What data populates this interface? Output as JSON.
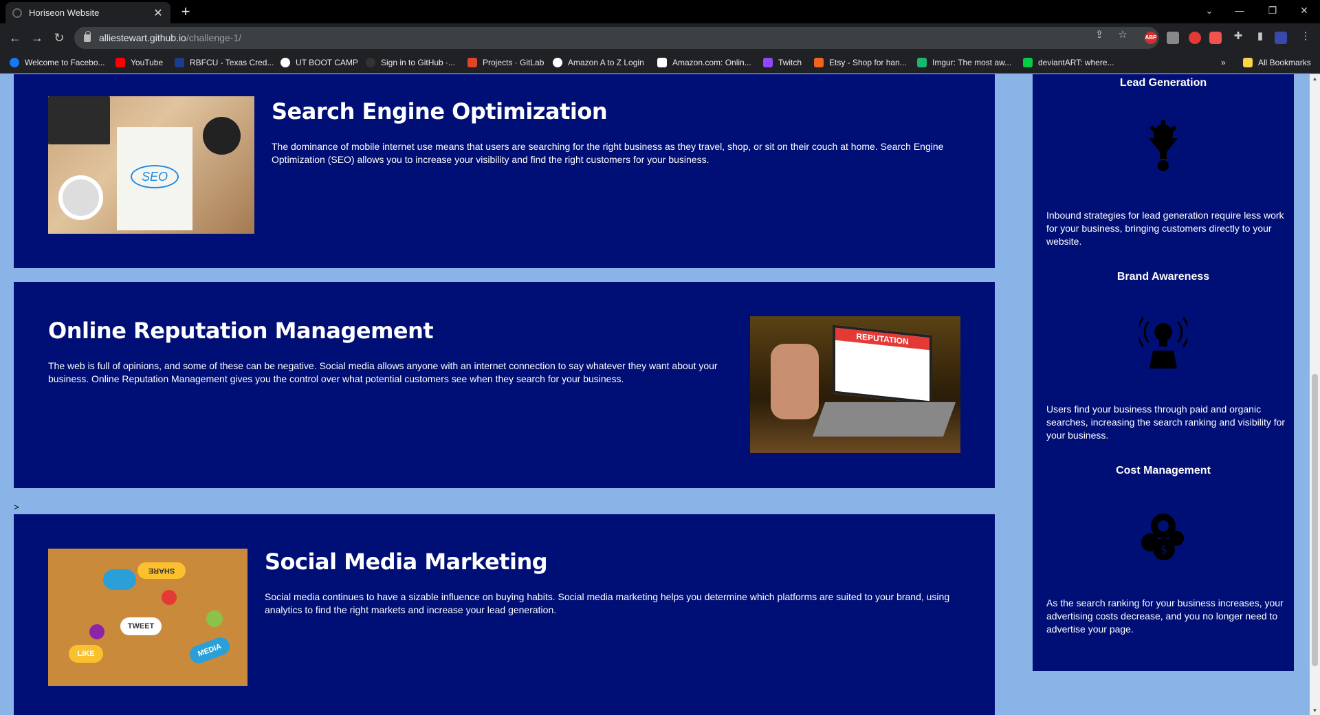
{
  "browser": {
    "tab_title": "Horiseon Website",
    "url_host": "alliestewart.github.io",
    "url_path": "/challenge-1/",
    "bookmarks": [
      "Welcome to Facebo...",
      "YouTube",
      "RBFCU - Texas Cred...",
      "UT BOOT CAMP",
      "Sign in to GitHub ·...",
      "Projects · GitLab",
      "Amazon A to Z Login",
      "Amazon.com: Onlin...",
      "Twitch",
      "Etsy - Shop for han...",
      "Imgur: The most aw...",
      "deviantART: where...",
      "All Bookmarks"
    ],
    "overflow_label": "»",
    "extensions": [
      "ABP"
    ]
  },
  "page": {
    "stray_text": ">",
    "seo": {
      "heading": "Search Engine Optimization",
      "text": "The dominance of mobile internet use means that users are searching for the right business as they travel, shop, or sit on their couch at home. Search Engine Optimization (SEO) allows you to increase your visibility and find the right customers for your business.",
      "image_text": "SEO"
    },
    "orm": {
      "heading": "Online Reputation Management",
      "text": "The web is full of opinions, and some of these can be negative. Social media allows anyone with an internet connection to say whatever they want about your business. Online Reputation Management gives you the control over what potential customers see when they search for your business.",
      "image_text": "REPUTATION"
    },
    "smm": {
      "heading": "Social Media Marketing",
      "text": "Social media continues to have a sizable influence on buying habits. Social media marketing helps you determine which platforms are suited to your brand, using analytics to find the right markets and increase your lead generation.",
      "image_words": [
        "SHARE",
        "TWEET",
        "LIKE",
        "MEDIA"
      ]
    },
    "benefits": [
      {
        "title": "Lead Generation",
        "text": "Inbound strategies for lead generation require less work for your business, bringing customers directly to your website."
      },
      {
        "title": "Brand Awareness",
        "text": "Users find your business through paid and organic searches, increasing the search ranking and visibility for your business."
      },
      {
        "title": "Cost Management",
        "text": "As the search ranking for your business increases, your advertising costs decrease, and you no longer need to advertise your page."
      }
    ]
  },
  "colors": {
    "page_bg": "#8ab4e8",
    "card_bg": "#000f75",
    "chrome_bg": "#202124"
  }
}
